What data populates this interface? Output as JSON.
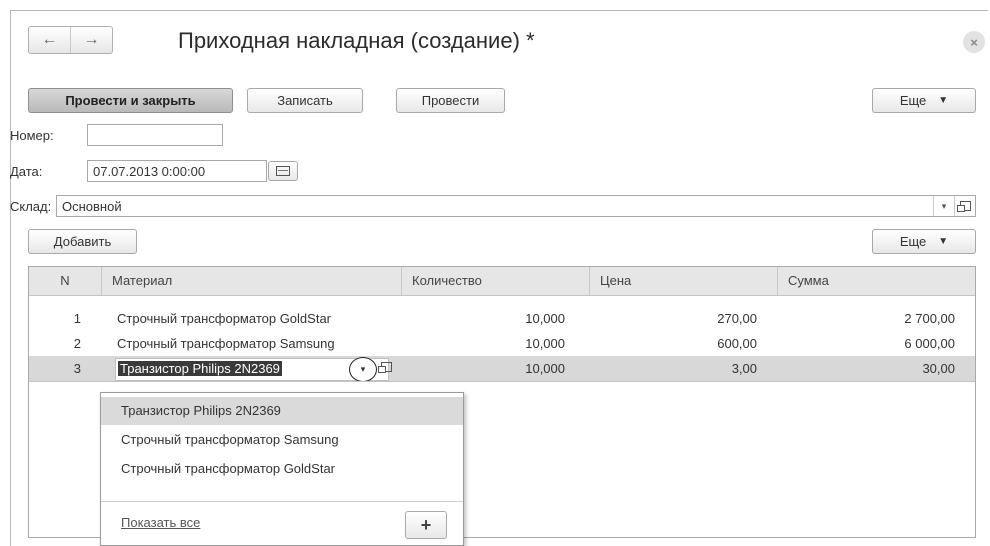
{
  "window": {
    "title": "Приходная накладная (создание) *",
    "back_icon": "←",
    "forward_icon": "→",
    "close_icon": "×"
  },
  "toolbar": {
    "post_close": "Провести и закрыть",
    "save": "Записать",
    "post": "Провести",
    "more": "Еще",
    "more_caret": "▼"
  },
  "form": {
    "number": {
      "label": "Номер:",
      "value": ""
    },
    "date": {
      "label": "Дата:",
      "value": "07.07.2013  0:00:00"
    },
    "warehouse": {
      "label": "Склад:",
      "value": "Основной"
    }
  },
  "table_toolbar": {
    "add": "Добавить",
    "more": "Еще",
    "more_caret": "▼"
  },
  "table": {
    "columns": [
      "N",
      "Материал",
      "Количество",
      "Цена",
      "Сумма"
    ],
    "rows": [
      {
        "n": "1",
        "material": "Строчный трансформатор GoldStar",
        "qty": "10,000",
        "price": "270,00",
        "sum": "2 700,00"
      },
      {
        "n": "2",
        "material": "Строчный трансформатор Samsung",
        "qty": "10,000",
        "price": "600,00",
        "sum": "6 000,00"
      },
      {
        "n": "3",
        "material": "Транзистор Philips 2N2369",
        "qty": "10,000",
        "price": "3,00",
        "sum": "30,00"
      }
    ]
  },
  "dropdown": {
    "items": [
      "Транзистор Philips 2N2369",
      "Строчный трансформатор Samsung",
      "Строчный трансформатор GoldStar"
    ],
    "show_all": "Показать все",
    "plus": "+"
  },
  "icons": {
    "dropdown_caret": "▾"
  }
}
